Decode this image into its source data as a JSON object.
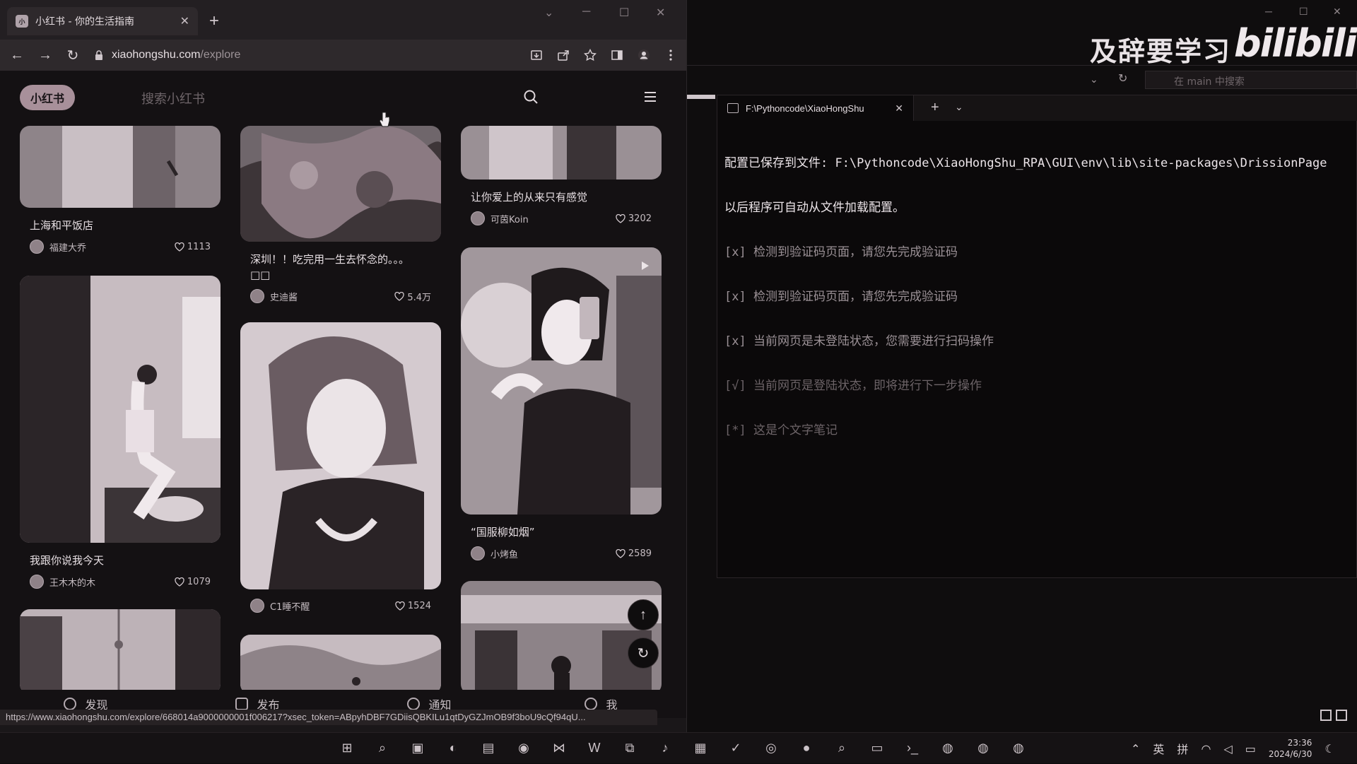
{
  "browser": {
    "tab_title": "小红书 - 你的生活指南",
    "favicon_text": "小",
    "new_tab": "+",
    "url_host": "xiaohongshu.com",
    "url_path": "/explore",
    "status_url": "https://www.xiaohongshu.com/explore/668014a9000000001f006217?xsec_token=ABpyhDBF7GDiisQBKILu1qtDyGZJmOB9f3boU9cQf94qU..."
  },
  "site": {
    "logo": "小红书",
    "search_placeholder": "搜索小红书"
  },
  "feed": [
    {
      "title": "上海和平饭店",
      "author": "福建大乔",
      "likes": "1113"
    },
    {
      "title": "深圳！！吃完用一生去怀念的。。。\n□□",
      "author": "史迪酱",
      "likes": "5.4万"
    },
    {
      "title": "让你爱上的从来只有感觉",
      "author": "可茵Koin",
      "likes": "3202"
    },
    {
      "title": "我跟你说我今天",
      "author": "王木木的木",
      "likes": "1079"
    },
    {
      "title": "",
      "author": "C1睡不醒",
      "likes": "1524"
    },
    {
      "title": "“国服柳如烟”",
      "author": "小烤鱼",
      "likes": "2589"
    }
  ],
  "bottom_nav": [
    {
      "label": "发现"
    },
    {
      "label": "发布"
    },
    {
      "label": "通知"
    },
    {
      "label": "我"
    }
  ],
  "overlay": {
    "watermark": "及辞要学习",
    "bili": "bilibili"
  },
  "ide": {
    "search_placeholder": "在 main 中搜索"
  },
  "terminal": {
    "tab_title": "F:\\Pythoncode\\XiaoHongShu",
    "lines": [
      "配置已保存到文件: F:\\Pythoncode\\XiaoHongShu_RPA\\GUI\\env\\lib\\site-packages\\DrissionPage",
      "以后程序可自动从文件加载配置。",
      "[x] 检测到验证码页面，请您先完成验证码",
      "[x] 检测到验证码页面，请您先完成验证码",
      "[x] 当前网页是未登陆状态，您需要进行扫码操作",
      "[√] 当前网页是登陆状态，即将进行下一步操作",
      "[*] 这是个文字笔记"
    ]
  },
  "taskbar": {
    "lang1": "英",
    "lang2": "拼",
    "time": "23:36",
    "date": "2024/6/30"
  },
  "colors": {
    "page_bg": "#141113",
    "accent": "#a8909a"
  }
}
